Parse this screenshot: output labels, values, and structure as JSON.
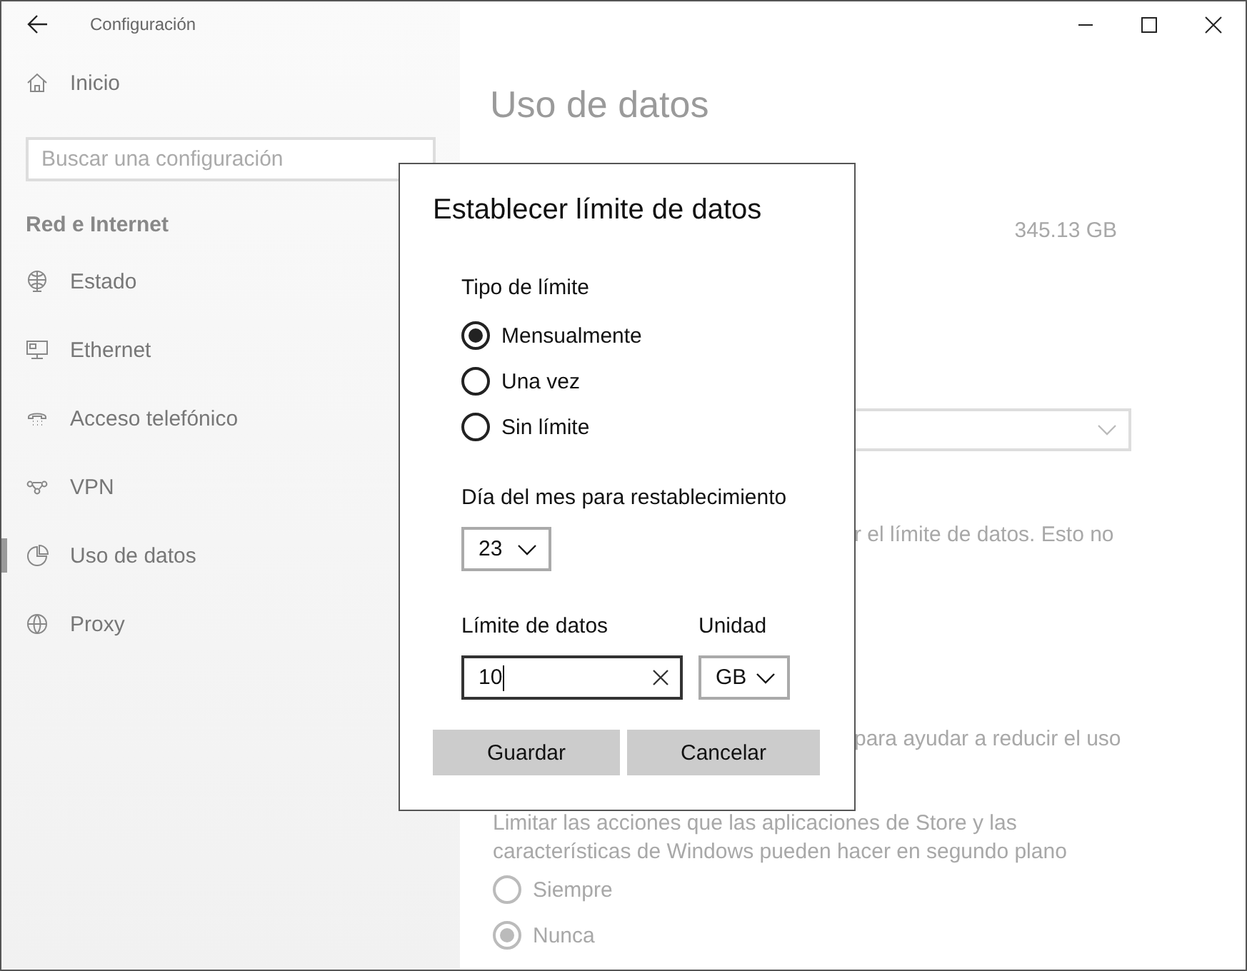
{
  "window": {
    "title": "Configuración"
  },
  "sidebar": {
    "home": "Inicio",
    "search": {
      "placeholder": "Buscar una configuración"
    },
    "section_title": "Red e Internet",
    "items": [
      {
        "label": "Estado",
        "selected": false
      },
      {
        "label": "Ethernet",
        "selected": false
      },
      {
        "label": "Acceso telefónico",
        "selected": false
      },
      {
        "label": "VPN",
        "selected": false
      },
      {
        "label": "Uso de datos",
        "selected": true
      },
      {
        "label": "Proxy",
        "selected": false
      }
    ]
  },
  "page": {
    "title": "Uso de datos",
    "total": "345.13 GB",
    "partial_text_1": "r el límite de datos. Esto no",
    "partial_text_2": "para ayudar a reducir el uso",
    "background_description": "Limitar las acciones que las aplicaciones de Store y las características de Windows pueden hacer en segundo plano",
    "background_options": [
      {
        "label": "Siempre",
        "selected": false
      },
      {
        "label": "Nunca",
        "selected": true
      }
    ]
  },
  "dialog": {
    "title": "Establecer límite de datos",
    "limit_type": {
      "label": "Tipo de límite",
      "options": [
        {
          "label": "Mensualmente",
          "selected": true
        },
        {
          "label": "Una vez",
          "selected": false
        },
        {
          "label": "Sin límite",
          "selected": false
        }
      ]
    },
    "reset_day": {
      "label": "Día del mes para restablecimiento",
      "value": "23"
    },
    "data_limit": {
      "label": "Límite de datos",
      "value": "10"
    },
    "unit": {
      "label": "Unidad",
      "value": "GB"
    },
    "buttons": [
      "Guardar",
      "Cancelar"
    ]
  }
}
